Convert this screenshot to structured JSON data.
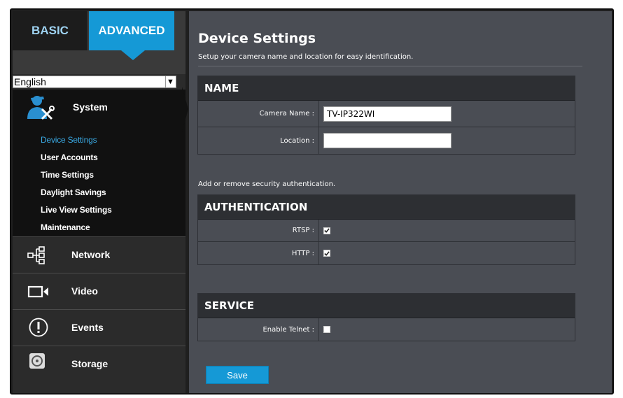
{
  "tabs": {
    "basic": "BASIC",
    "advanced": "ADVANCED"
  },
  "language": {
    "selected": "English"
  },
  "sidebar": {
    "system": {
      "label": "System",
      "items": [
        {
          "label": "Device Settings",
          "active": true
        },
        {
          "label": "User Accounts"
        },
        {
          "label": "Time Settings"
        },
        {
          "label": "Daylight Savings"
        },
        {
          "label": "Live View Settings"
        },
        {
          "label": "Maintenance"
        }
      ]
    },
    "network": {
      "label": "Network"
    },
    "video": {
      "label": "Video"
    },
    "events": {
      "label": "Events"
    },
    "storage": {
      "label": "Storage"
    }
  },
  "page": {
    "title": "Device Settings",
    "subtitle": "Setup your camera name and location for easy identification.",
    "auth_note": "Add or remove security authentication.",
    "save_label": "Save"
  },
  "name_section": {
    "title": "NAME",
    "camera_name_label": "Camera Name :",
    "camera_name_value": "TV-IP322WI",
    "location_label": "Location :",
    "location_value": ""
  },
  "auth_section": {
    "title": "AUTHENTICATION",
    "rtsp_label": "RTSP :",
    "rtsp_checked": true,
    "http_label": "HTTP :",
    "http_checked": true
  },
  "service_section": {
    "title": "SERVICE",
    "telnet_label": "Enable Telnet :",
    "telnet_checked": false
  },
  "colors": {
    "accent": "#1599d6",
    "active_link": "#3aa9e3",
    "panel": "#4a4d54"
  }
}
